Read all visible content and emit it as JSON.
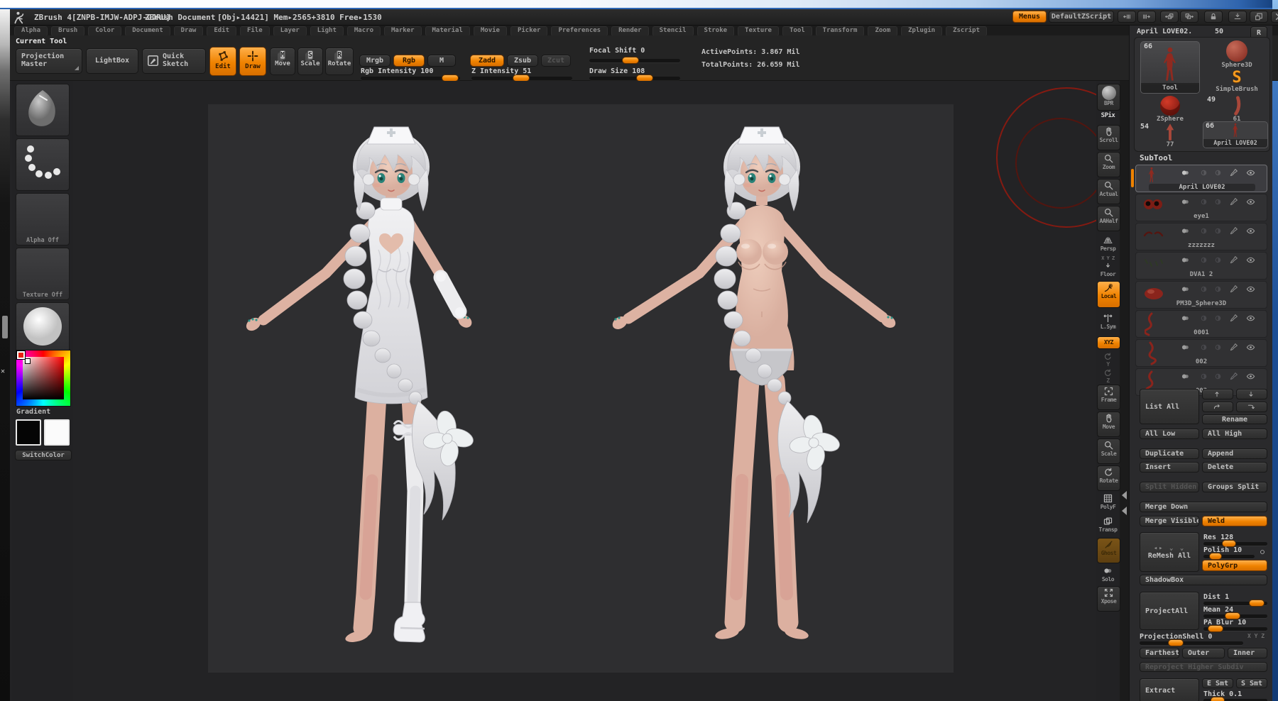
{
  "window": {
    "title": "ZBrush 4[ZNPB-IMJW-ADPJ-GJRU]",
    "document_label": "ZBrush Document",
    "stats": "[Obj▸14421] Mem▸2565+3810 Free▸1530",
    "menus": "Menus",
    "default_zscript": "DefaultZScript"
  },
  "menu_items": [
    "Alpha",
    "Brush",
    "Color",
    "Document",
    "Draw",
    "Edit",
    "File",
    "Layer",
    "Light",
    "Macro",
    "Marker",
    "Material",
    "Movie",
    "Picker",
    "Preferences",
    "Render",
    "Stencil",
    "Stroke",
    "Texture",
    "Tool",
    "Transform",
    "Zoom",
    "Zplugin",
    "Zscript"
  ],
  "toolbar": {
    "current_tool": "Current Tool",
    "projection_master": "Projection Master",
    "lightbox": "LightBox",
    "quick_sketch": "Quick Sketch",
    "edit": "Edit",
    "draw": "Draw",
    "move": "Move",
    "scale": "Scale",
    "rotate": "Rotate",
    "move_glyph": "M",
    "scale_glyph": "S",
    "rotate_glyph": "R",
    "mrgb": "Mrgb",
    "rgb": "Rgb",
    "m": "M",
    "rgb_intensity": "Rgb Intensity 100",
    "zadd": "Zadd",
    "zsub": "Zsub",
    "zcut": "Zcut",
    "z_intensity": "Z Intensity 51",
    "focal_shift": "Focal Shift 0",
    "draw_size": "Draw Size 108",
    "active_points": "ActivePoints: 3.867 Mil",
    "total_points": "TotalPoints: 26.659 Mil"
  },
  "left_shelf": {
    "brush": "Move",
    "stroke": "Dots",
    "alpha": "Alpha Off",
    "texture": "Texture Off",
    "material": "SkinShade4",
    "gradient": "Gradient",
    "switch_color": "SwitchColor"
  },
  "right_strip": [
    {
      "label": "BPR"
    },
    {
      "label": "SPix"
    },
    {
      "label": "Scroll"
    },
    {
      "label": "Zoom"
    },
    {
      "label": "Actual"
    },
    {
      "label": "AAHalf"
    },
    {
      "label": "Persp"
    },
    {
      "label": "Floor",
      "axes": "X Y Z"
    },
    {
      "label": "Local"
    },
    {
      "label": "L.Sym"
    },
    {
      "label": "XYZ"
    },
    {
      "label": "Y"
    },
    {
      "label": "Z"
    },
    {
      "label": "Frame"
    },
    {
      "label": "Move"
    },
    {
      "label": "Scale"
    },
    {
      "label": "Rotate"
    },
    {
      "label": "PolyF"
    },
    {
      "label": "Transp"
    },
    {
      "label": "Ghost"
    },
    {
      "label": "Solo"
    },
    {
      "label": "Xpose"
    }
  ],
  "tool_palette": {
    "name": "April LOVE02.",
    "value": "50",
    "r_button": "R",
    "big_badge": "66",
    "big_caption": "Tool",
    "sphere3d": "Sphere3D",
    "simplebrush": "SimpleBrush",
    "simplebrush_glyph": "S",
    "zsphere": "ZSphere",
    "item61_badge": "49",
    "item61": "61",
    "item77_badge": "54",
    "item77": "77",
    "april_badge": "66",
    "april": "April LOVE02"
  },
  "subtool": {
    "title": "SubTool",
    "rows": [
      {
        "name": "April LOVE02"
      },
      {
        "name": "eye1"
      },
      {
        "name": "zzzzzzz"
      },
      {
        "name": "DVA1 2"
      },
      {
        "name": "PM3D_Sphere3D"
      },
      {
        "name": "0001"
      },
      {
        "name": "002"
      },
      {
        "name": "003"
      }
    ],
    "list_all": "List All",
    "rename": "Rename",
    "all_low": "All Low",
    "all_high": "All High",
    "duplicate": "Duplicate",
    "append": "Append",
    "insert": "Insert",
    "delete": "Delete",
    "split_hidden": "Split Hidden",
    "groups_split": "Groups Split",
    "merge_down": "Merge Down",
    "merge_visible": "Merge Visible",
    "weld": "Weld"
  },
  "remesh": {
    "remesh_all": "ReMesh All",
    "res": "Res 128",
    "polish": "Polish 10",
    "polygrp": "PolyGrp",
    "shadowbox": "ShadowBox"
  },
  "project": {
    "project_all": "ProjectAll",
    "dist": "Dist 1",
    "mean": "Mean 24",
    "pa_blur": "PA Blur 10",
    "projection_shell": "ProjectionShell 0",
    "axes": "X Y Z",
    "farthest": "Farthest",
    "outer": "Outer",
    "inner": "Inner",
    "reproject": "Reproject Higher Subdiv"
  },
  "extract": {
    "extract": "Extract",
    "e_smt": "E Smt",
    "s_smt": "S Smt",
    "thick": "Thick 0.1"
  },
  "colors": {
    "accent_orange": "#ef8200",
    "cursor_ring_red": "#8a1a12",
    "document_bg": "#2e2e30",
    "panel_bg": "#2a2a2c"
  }
}
